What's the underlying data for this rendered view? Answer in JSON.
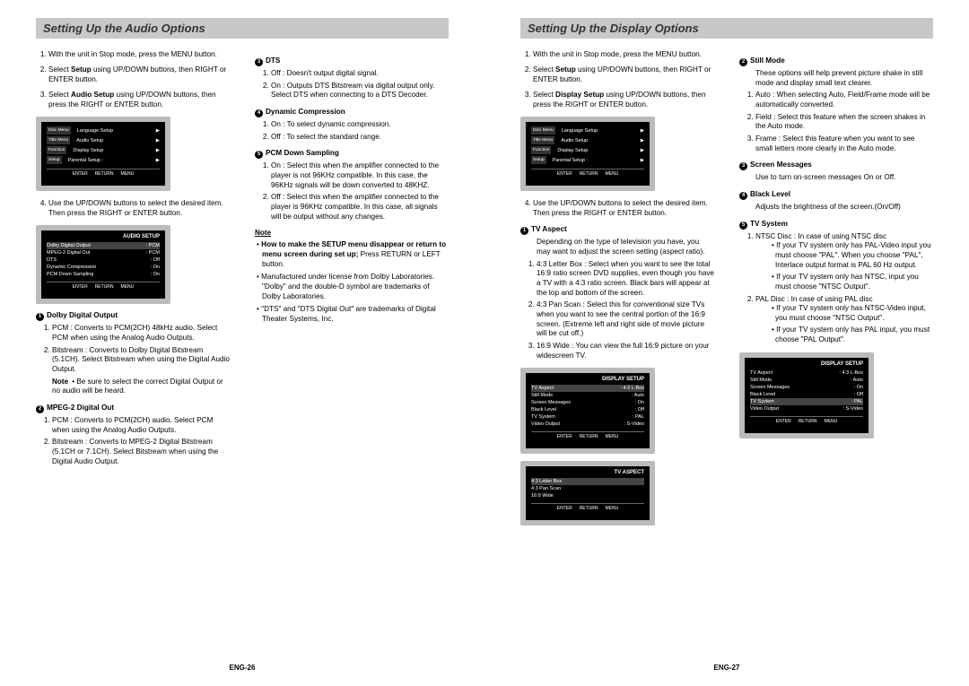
{
  "left": {
    "header": "Setting Up the Audio Options",
    "steps": [
      "With the unit in Stop mode, press the MENU button.",
      "Select <b>Setup</b> using UP/DOWN buttons, then RIGHT or ENTER button.",
      "Select <b>Audio Setup</b> using UP/DOWN buttons, then press the RIGHT or ENTER button.",
      "Use the UP/DOWN buttons to select the desired item. Then press the RIGHT or ENTER button."
    ],
    "shot1": {
      "side": [
        "Disc Menu",
        "Title Menu",
        "Function",
        "Setup"
      ],
      "rows": [
        "Language Setup",
        "Audio Setup",
        "Display Setup",
        "Parental Setup :"
      ],
      "selected": 1
    },
    "shot2": {
      "title": "AUDIO SETUP",
      "rows": [
        {
          "l": "Dolby Digital Output",
          "r": ": PCM"
        },
        {
          "l": "MPEG-2 Digital Out",
          "r": ": PCM"
        },
        {
          "l": "DTS",
          "r": ": Off"
        },
        {
          "l": "Dynamic Compression",
          "r": ": On"
        },
        {
          "l": "PCM Down Sampling",
          "r": ": On"
        }
      ],
      "footer": [
        "ENTER",
        "RETURN",
        "MENU"
      ]
    },
    "items": [
      {
        "n": "1",
        "title": "Dolby Digital Output",
        "sub": [
          "PCM : Converts to PCM(2CH) 48kHz audio. Select PCM when using the Analog Audio Outputs.",
          "Bitstream : Converts to Dolby Digital Bitstream (5.1CH). Select Bitstream when using the Digital Audio Output."
        ],
        "note": "Be sure to select the correct Digital Output or no audio will be heard."
      },
      {
        "n": "2",
        "title": "MPEG-2 Digital Out",
        "sub": [
          "PCM : Converts to PCM(2CH) audio. Select PCM when using the Analog Audio Outputs.",
          "Bitstream : Converts to MPEG-2 Digital Bitstream (5.1CH or 7.1CH). Select Bitstream when using the Digital Audio Output."
        ]
      }
    ],
    "items_r": [
      {
        "n": "3",
        "title": "DTS",
        "sub": [
          "Off : Doesn't output digital signal.",
          "On : Outputs DTS Bitstream via digital output only. Select DTS when connecting to a DTS Decoder."
        ]
      },
      {
        "n": "4",
        "title": "Dynamic Compression",
        "sub": [
          "On : To select dynamic compression.",
          "Off : To select the standard range."
        ]
      },
      {
        "n": "5",
        "title": "PCM Down Sampling",
        "sub": [
          "On : Select this when the amplifier connected to the player is not 96KHz compatible. In this case, the 96KHz signals will be down converted to 48KHZ.",
          "Off : Select this when the amplifier connected to the player is 96KHz compatible. In this case, all signals will be output without any changes."
        ]
      }
    ],
    "note_title": "Note",
    "note_bullets": [
      "<b>How to make the SETUP menu disappear or return to menu screen during set up;</b> Press RETURN or LEFT button.",
      "Manufactured under license from Dolby Laboratories. \"Dolby\" and the double-D symbol are trademarks of Dolby Laboratories.",
      "\"DTS\" and \"DTS Digital Out\" are trademarks of Digital Theater Systems, Inc."
    ],
    "footer": "ENG-26"
  },
  "right": {
    "header": "Setting Up the Display Options",
    "steps": [
      "With the unit in Stop mode, press the MENU button.",
      "Select <b>Setup</b> using UP/DOWN buttons, then RIGHT or ENTER button.",
      "Select <b>Display Setup</b> using UP/DOWN buttons, then press the RIGHT or ENTER button.",
      "Use the UP/DOWN buttons to select the desired item. Then press the RIGHT or ENTER button."
    ],
    "shot1": {
      "side": [
        "Disc Menu",
        "Title Menu",
        "Function",
        "Setup"
      ],
      "rows": [
        "Language Setup",
        "Audio Setup",
        "Display Setup",
        "Parental Setup :"
      ],
      "selected": 2
    },
    "item1": {
      "n": "1",
      "title": "TV Aspect",
      "intro": "Depending on the type of television you have, you may want to adjust the screen setting (aspect ratio).",
      "sub": [
        "4:3 Letter Box : Select when you want to see the total 16:9 ratio screen DVD supplies, even though you have a TV with a 4:3 ratio screen. Black bars will appear at the top and bottom of the screen.",
        "4:3 Pan Scan : Select this for conventional size TVs when you want to see the central portion of the 16:9 screen. (Extreme left and right side of movie picture will be cut off.)",
        "16:9 Wide : You can view the full 16:9 picture on your widescreen TV."
      ]
    },
    "shot_disp": {
      "title": "DISPLAY SETUP",
      "rows": [
        {
          "l": "TV Aspect",
          "r": ": 4:3 L-Box"
        },
        {
          "l": "Still Mode",
          "r": ": Auto"
        },
        {
          "l": "Screen Messages",
          "r": ": On"
        },
        {
          "l": "Black Level",
          "r": ": Off"
        },
        {
          "l": "TV System",
          "r": ": PAL"
        },
        {
          "l": "Video Output",
          "r": ": S-Video"
        }
      ]
    },
    "shot_aspect": {
      "title": "TV ASPECT",
      "rows": [
        "4:3 Letter Box",
        "4:3 Pan Scan",
        "16:9 Wide"
      ]
    },
    "items_r": [
      {
        "n": "2",
        "title": "Still Mode",
        "intro": "These options will help prevent picture shake in still mode and display small text clearer.",
        "sub": [
          "Auto : When selecting Auto, Field/Frame mode will be automatically converted.",
          "Field : Select this feature when the screen shakes in the Auto mode.",
          "Frame : Select this feature when you want to see small letters more clearly in the Auto mode."
        ]
      },
      {
        "n": "3",
        "title": "Screen Messages",
        "intro": "Use to turn on-screen messages On or Off."
      },
      {
        "n": "4",
        "title": "Black Level",
        "intro": "Adjusts the brightness of the screen.(On/Off)"
      },
      {
        "n": "5",
        "title": "TV System",
        "sub2": [
          {
            "h": "NTSC Disc : In case of using NTSC disc",
            "b": [
              "If your TV system only has PAL-Video input you must choose \"PAL\". When you choose \"PAL\", Interlace output format is PAL 60 Hz output.",
              "If your TV system only has NTSC, input you must choose \"NTSC Output\"."
            ]
          },
          {
            "h": "PAL Disc : In case of using PAL disc",
            "b": [
              "If your TV system only has NTSC-Video input, you must choose \"NTSC Output\".",
              "If your TV system only has PAL input, you must choose \"PAL Output\"."
            ]
          }
        ]
      }
    ],
    "shot_disp2": {
      "title": "DISPLAY SETUP",
      "rows": [
        {
          "l": "TV Aspect",
          "r": ": 4:3 L-Box"
        },
        {
          "l": "Still Mode",
          "r": ": Auto"
        },
        {
          "l": "Screen Messages",
          "r": ": On"
        },
        {
          "l": "Black Level",
          "r": ": Off"
        },
        {
          "l": "TV System",
          "r": ": PAL"
        },
        {
          "l": "Video Output",
          "r": ": S-Video"
        }
      ],
      "sel": 4
    },
    "footer": "ENG-27"
  }
}
